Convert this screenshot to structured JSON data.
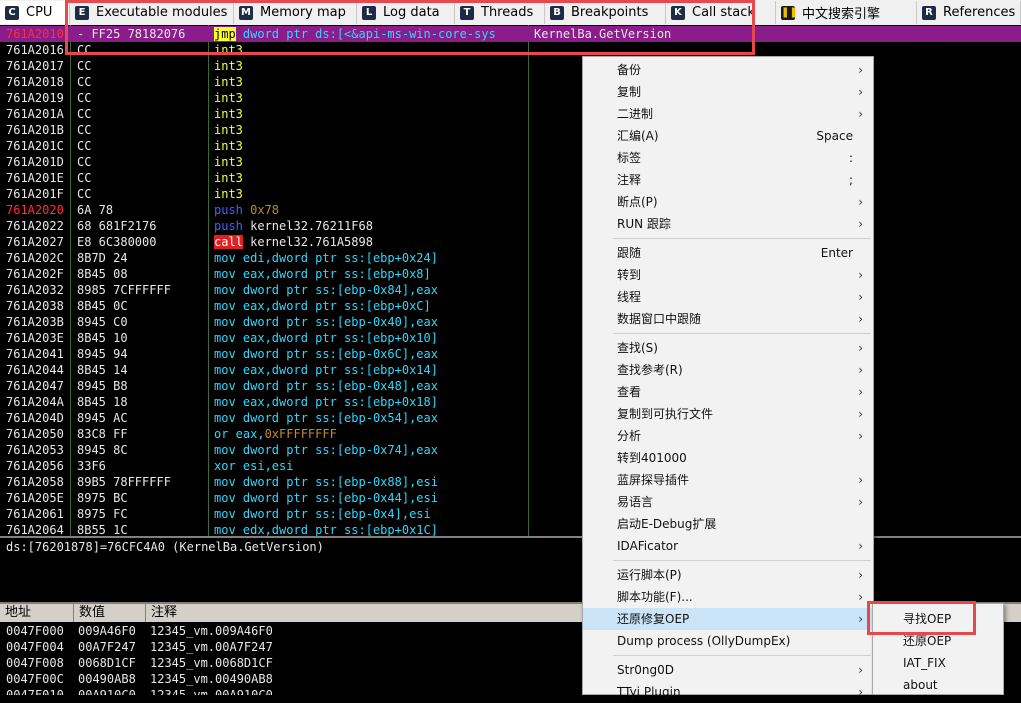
{
  "tabs": [
    {
      "label": "CPU",
      "icon": "C",
      "icon_name": "cpu-icon"
    },
    {
      "label": "Executable modules",
      "icon": "E",
      "icon_name": "modules-icon"
    },
    {
      "label": "Memory map",
      "icon": "M",
      "icon_name": "memory-icon"
    },
    {
      "label": "Log data",
      "icon": "L",
      "icon_name": "log-icon"
    },
    {
      "label": "Threads",
      "icon": "T",
      "icon_name": "threads-icon"
    },
    {
      "label": "Breakpoints",
      "icon": "B",
      "icon_name": "breakpoints-icon"
    },
    {
      "label": "Call stack",
      "icon": "K",
      "icon_name": "callstack-icon"
    },
    {
      "label": "中文搜索引擎",
      "icon": "❚❚",
      "icon_name": "plugin-pause-icon"
    },
    {
      "label": "References",
      "icon": "R",
      "icon_name": "references-icon"
    }
  ],
  "disasm": [
    {
      "addr": "761A2010",
      "bytes": "- FF25 78182076",
      "parts": [
        [
          "jmp",
          "k-jmpbox"
        ],
        [
          " dword ptr ds:[<&api-ms-win-core-sys",
          "k-cyan"
        ]
      ],
      "comment": "KernelBa.GetVersion",
      "sel": true,
      "red": true
    },
    {
      "addr": "761A2016",
      "bytes": "CC",
      "parts": [
        [
          "int3",
          "k-yellow"
        ]
      ]
    },
    {
      "addr": "761A2017",
      "bytes": "CC",
      "parts": [
        [
          "int3",
          "k-yellow"
        ]
      ]
    },
    {
      "addr": "761A2018",
      "bytes": "CC",
      "parts": [
        [
          "int3",
          "k-yellow"
        ]
      ]
    },
    {
      "addr": "761A2019",
      "bytes": "CC",
      "parts": [
        [
          "int3",
          "k-yellow"
        ]
      ]
    },
    {
      "addr": "761A201A",
      "bytes": "CC",
      "parts": [
        [
          "int3",
          "k-yellow"
        ]
      ]
    },
    {
      "addr": "761A201B",
      "bytes": "CC",
      "parts": [
        [
          "int3",
          "k-yellow"
        ]
      ]
    },
    {
      "addr": "761A201C",
      "bytes": "CC",
      "parts": [
        [
          "int3",
          "k-yellow"
        ]
      ]
    },
    {
      "addr": "761A201D",
      "bytes": "CC",
      "parts": [
        [
          "int3",
          "k-yellow"
        ]
      ]
    },
    {
      "addr": "761A201E",
      "bytes": "CC",
      "parts": [
        [
          "int3",
          "k-yellow"
        ]
      ]
    },
    {
      "addr": "761A201F",
      "bytes": "CC",
      "parts": [
        [
          "int3",
          "k-yellow"
        ]
      ]
    },
    {
      "addr": "761A2020",
      "bytes": "6A 78",
      "parts": [
        [
          "push",
          "k-blue"
        ],
        [
          " 0x78",
          "k-num"
        ]
      ],
      "red": true
    },
    {
      "addr": "761A2022",
      "bytes": "68 681F2176",
      "parts": [
        [
          "push",
          "k-blue"
        ],
        [
          " kernel32.76211F68",
          "k-text"
        ]
      ]
    },
    {
      "addr": "761A2027",
      "bytes": "E8 6C380000",
      "parts": [
        [
          "call",
          "k-callbox"
        ],
        [
          " kernel32.761A5898",
          "k-text"
        ]
      ]
    },
    {
      "addr": "761A202C",
      "bytes": "8B7D 24",
      "parts": [
        [
          "mov edi,dword ptr ss:[ebp+0x24]",
          "k-cyan"
        ]
      ]
    },
    {
      "addr": "761A202F",
      "bytes": "8B45 08",
      "parts": [
        [
          "mov eax,dword ptr ss:[ebp+0x8]",
          "k-cyan"
        ]
      ]
    },
    {
      "addr": "761A2032",
      "bytes": "8985 7CFFFFFF",
      "parts": [
        [
          "mov dword ptr ss:[ebp-0x84],eax",
          "k-cyan"
        ]
      ]
    },
    {
      "addr": "761A2038",
      "bytes": "8B45 0C",
      "parts": [
        [
          "mov eax,dword ptr ss:[ebp+0xC]",
          "k-cyan"
        ]
      ]
    },
    {
      "addr": "761A203B",
      "bytes": "8945 C0",
      "parts": [
        [
          "mov dword ptr ss:[ebp-0x40],eax",
          "k-cyan"
        ]
      ]
    },
    {
      "addr": "761A203E",
      "bytes": "8B45 10",
      "parts": [
        [
          "mov eax,dword ptr ss:[ebp+0x10]",
          "k-cyan"
        ]
      ]
    },
    {
      "addr": "761A2041",
      "bytes": "8945 94",
      "parts": [
        [
          "mov dword ptr ss:[ebp-0x6C],eax",
          "k-cyan"
        ]
      ]
    },
    {
      "addr": "761A2044",
      "bytes": "8B45 14",
      "parts": [
        [
          "mov eax,dword ptr ss:[ebp+0x14]",
          "k-cyan"
        ]
      ]
    },
    {
      "addr": "761A2047",
      "bytes": "8945 B8",
      "parts": [
        [
          "mov dword ptr ss:[ebp-0x48],eax",
          "k-cyan"
        ]
      ]
    },
    {
      "addr": "761A204A",
      "bytes": "8B45 18",
      "parts": [
        [
          "mov eax,dword ptr ss:[ebp+0x18]",
          "k-cyan"
        ]
      ]
    },
    {
      "addr": "761A204D",
      "bytes": "8945 AC",
      "parts": [
        [
          "mov dword ptr ss:[ebp-0x54],eax",
          "k-cyan"
        ]
      ]
    },
    {
      "addr": "761A2050",
      "bytes": "83C8 FF",
      "parts": [
        [
          "or eax,",
          "k-cyan"
        ],
        [
          "0xFFFFFFFF",
          "k-num"
        ]
      ]
    },
    {
      "addr": "761A2053",
      "bytes": "8945 8C",
      "parts": [
        [
          "mov dword ptr ss:[ebp-0x74],eax",
          "k-cyan"
        ]
      ]
    },
    {
      "addr": "761A2056",
      "bytes": "33F6",
      "parts": [
        [
          "xor esi,esi",
          "k-cyan"
        ]
      ]
    },
    {
      "addr": "761A2058",
      "bytes": "89B5 78FFFFFF",
      "parts": [
        [
          "mov dword ptr ss:[ebp-0x88],esi",
          "k-cyan"
        ]
      ]
    },
    {
      "addr": "761A205E",
      "bytes": "8975 BC",
      "parts": [
        [
          "mov dword ptr ss:[ebp-0x44],esi",
          "k-cyan"
        ]
      ]
    },
    {
      "addr": "761A2061",
      "bytes": "8975 FC",
      "parts": [
        [
          "mov dword ptr ss:[ebp-0x4],esi",
          "k-cyan"
        ]
      ]
    },
    {
      "addr": "761A2064",
      "bytes": "8B55 1C",
      "parts": [
        [
          "mov edx,dword ptr ss:[ebp+0x1C]",
          "k-cyan"
        ]
      ]
    }
  ],
  "info_line": "ds:[76201878]=76CFC4A0 (KernelBa.GetVersion)",
  "dump_headers": {
    "address": "地址",
    "value": "数值",
    "comment": "注释"
  },
  "dump_rows": [
    {
      "addr": "0047F000",
      "val": "009A46F0",
      "cmt": "12345_vm.009A46F0"
    },
    {
      "addr": "0047F004",
      "val": "00A7F247",
      "cmt": "12345_vm.00A7F247"
    },
    {
      "addr": "0047F008",
      "val": "0068D1CF",
      "cmt": "12345_vm.0068D1CF"
    },
    {
      "addr": "0047F00C",
      "val": "00490AB8",
      "cmt": "12345_vm.00490AB8"
    },
    {
      "addr": "0047F010",
      "val": "00A910C0",
      "cmt": "12345_vm.00A910C0"
    }
  ],
  "context_menu": [
    {
      "label": "备份",
      "arrow": true
    },
    {
      "label": "复制",
      "arrow": true
    },
    {
      "label": "二进制",
      "arrow": true
    },
    {
      "label": "汇编(A)",
      "shortcut": "Space"
    },
    {
      "label": "标签",
      "shortcut": ":"
    },
    {
      "label": "注释",
      "shortcut": ";"
    },
    {
      "label": "断点(P)",
      "arrow": true
    },
    {
      "label": "RUN 跟踪",
      "arrow": true
    },
    {
      "sep": true
    },
    {
      "label": "跟随",
      "shortcut": "Enter"
    },
    {
      "label": "转到",
      "arrow": true
    },
    {
      "label": "线程",
      "arrow": true
    },
    {
      "label": "数据窗口中跟随",
      "arrow": true
    },
    {
      "sep": true
    },
    {
      "label": "查找(S)",
      "arrow": true
    },
    {
      "label": "查找参考(R)",
      "arrow": true
    },
    {
      "label": "查看",
      "arrow": true
    },
    {
      "label": "复制到可执行文件",
      "arrow": true
    },
    {
      "label": "分析",
      "arrow": true
    },
    {
      "label": "转到401000"
    },
    {
      "label": "蓝屏探导插件",
      "arrow": true
    },
    {
      "label": "易语言",
      "arrow": true
    },
    {
      "label": "启动E-Debug扩展"
    },
    {
      "label": "IDAFicator",
      "arrow": true
    },
    {
      "sep": true
    },
    {
      "label": "运行脚本(P)",
      "arrow": true
    },
    {
      "label": "脚本功能(F)...",
      "arrow": true
    },
    {
      "label": "还原修复OEP",
      "arrow": true,
      "highlight": true
    },
    {
      "label": "Dump process (OllyDumpEx)"
    },
    {
      "sep": true
    },
    {
      "label": "Str0ng0D",
      "arrow": true
    },
    {
      "label": "TTyi Plugin",
      "arrow": true
    }
  ],
  "submenu": [
    {
      "label": "寻找OEP"
    },
    {
      "label": "还原OEP"
    },
    {
      "label": "IAT_FIX"
    },
    {
      "label": "about"
    }
  ],
  "colors": {
    "selection": "#8a1d8a",
    "highlight_box": "#e5484d",
    "menu_hover": "#cce4f7"
  }
}
